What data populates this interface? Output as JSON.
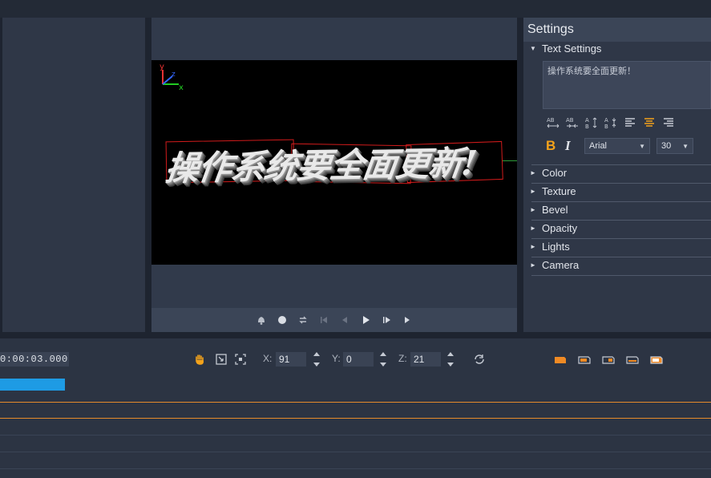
{
  "settings": {
    "title": "Settings",
    "text_settings_label": "Text Settings",
    "text_value": "操作系统要全面更新！",
    "font": "Arial",
    "font_size": "30",
    "bold_label": "B",
    "italic_label": "I",
    "sections": [
      "Color",
      "Texture",
      "Bevel",
      "Opacity",
      "Lights",
      "Camera"
    ],
    "accent_color": "#f3a21b"
  },
  "preview": {
    "title_text": "操作系统要全面更新!",
    "axis_labels": {
      "y": "y",
      "x": "x",
      "z": "z"
    }
  },
  "timeline": {
    "timecode": "0:00:03.000",
    "x_label": "X:",
    "x_value": "91",
    "y_label": "Y:",
    "y_value": "0",
    "z_label": "Z:",
    "z_value": "21",
    "clip_color": "#1e9be4",
    "track_line_color": "#e58a2a"
  },
  "icons": {
    "transport": [
      "bell-icon",
      "record-icon",
      "loop-icon",
      "go-start-icon",
      "prev-frame-icon",
      "play-icon",
      "next-frame-icon",
      "go-end-icon"
    ],
    "tools": [
      "hand-icon",
      "move-icon",
      "scale-icon"
    ],
    "presets": [
      "preset-1-icon",
      "preset-2-icon",
      "preset-3-icon",
      "preset-4-icon",
      "preset-5-icon"
    ]
  }
}
